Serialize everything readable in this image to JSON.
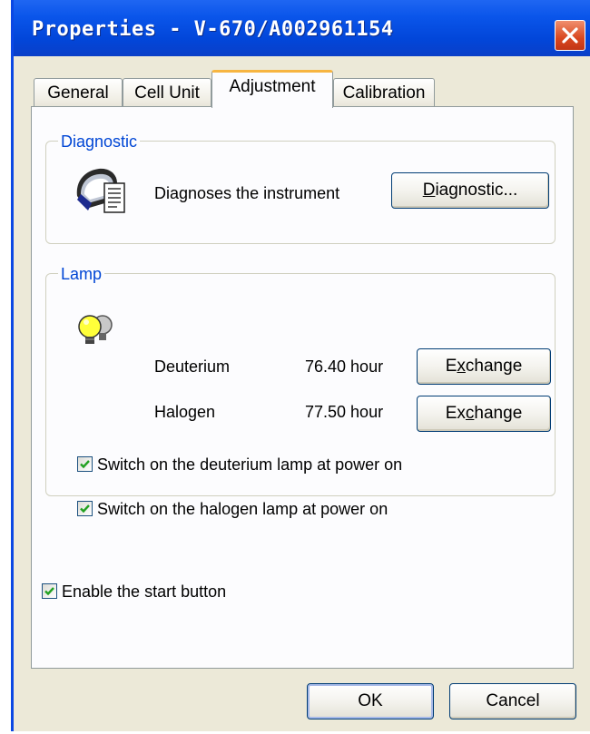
{
  "window": {
    "title": "Properties - V-670/A002961154"
  },
  "tabs": [
    {
      "label": "General"
    },
    {
      "label": "Cell Unit"
    },
    {
      "label": "Adjustment"
    },
    {
      "label": "Calibration"
    }
  ],
  "diagnostic": {
    "group_title": "Diagnostic",
    "description": "Diagnoses the instrument",
    "button_pre": "",
    "button_mnemonic": "D",
    "button_post": "iagnostic..."
  },
  "lamp": {
    "group_title": "Lamp",
    "deuterium_label": "Deuterium",
    "deuterium_hours": "76.40 hour",
    "deuterium_btn_pre": "E",
    "deuterium_btn_mnemonic": "x",
    "deuterium_btn_post": "change",
    "halogen_label": "Halogen",
    "halogen_hours": "77.50 hour",
    "halogen_btn_pre": "Ex",
    "halogen_btn_mnemonic": "c",
    "halogen_btn_post": "hange",
    "switch_deuterium": "Switch on the deuterium lamp at power on",
    "switch_halogen": "Switch on the halogen lamp at power on"
  },
  "enable_start": "Enable the start button",
  "footer": {
    "ok_label": "OK",
    "cancel_label": "Cancel"
  },
  "colors": {
    "title_bar": "#0a55ea",
    "group_title": "#0046d5",
    "active_tab_highlight": "#f7b541",
    "close_button": "#d9471f"
  }
}
